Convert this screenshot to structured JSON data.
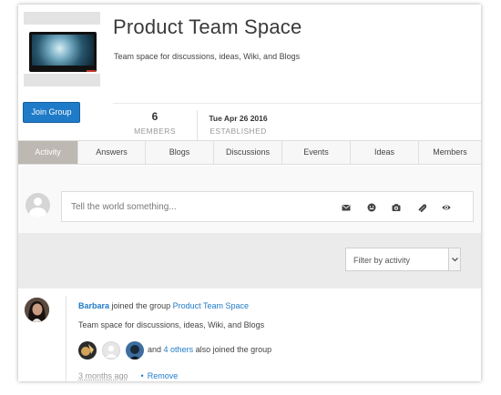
{
  "group": {
    "title": "Product Team Space",
    "description": "Team space for discussions, ideas, Wiki, and Blogs",
    "join_label": "Join Group"
  },
  "stats": {
    "members_value": "6",
    "members_label": "MEMBERS",
    "established_value": "Tue Apr 26 2016",
    "established_label": "ESTABLISHED"
  },
  "tabs": [
    {
      "label": "Activity",
      "active": true
    },
    {
      "label": "Answers"
    },
    {
      "label": "Blogs"
    },
    {
      "label": "Discussions"
    },
    {
      "label": "Events"
    },
    {
      "label": "Ideas"
    },
    {
      "label": "Members"
    }
  ],
  "composer": {
    "placeholder": "Tell the world something...",
    "icons": [
      "envelope-icon",
      "emoji-icon",
      "camera-icon",
      "attachment-icon",
      "eye-icon"
    ]
  },
  "filter": {
    "selected": "Filter by activity"
  },
  "feed": {
    "user": "Barbara",
    "action": "joined the group",
    "group_link": "Product Team Space",
    "group_desc": "Team space for discussions, ideas, Wiki, and Blogs",
    "and_text": "and",
    "others_link": "4 others",
    "others_suffix": "also joined the group",
    "time": "3 months ago",
    "remove_label": "Remove"
  },
  "colors": {
    "accent": "#1f7bc8",
    "active_tab": "#bdb8b1"
  }
}
